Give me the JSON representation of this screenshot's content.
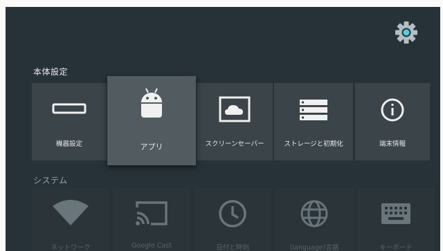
{
  "device_settings": {
    "title": "本体設定",
    "items": [
      {
        "label": "機器設定",
        "icon": "set-top-box-icon"
      },
      {
        "label": "アプリ",
        "icon": "android-icon"
      },
      {
        "label": "スクリーンセーバー",
        "icon": "screensaver-icon"
      },
      {
        "label": "ストレージと初期化",
        "icon": "storage-icon"
      },
      {
        "label": "端末情報",
        "icon": "info-icon"
      }
    ]
  },
  "system": {
    "title": "システム",
    "items": [
      {
        "label": "ネットワーク",
        "icon": "wifi-icon"
      },
      {
        "label": "Google Cast",
        "icon": "cast-icon"
      },
      {
        "label": "日付と時刻",
        "icon": "clock-icon"
      },
      {
        "label": "(language)言語",
        "icon": "globe-icon"
      },
      {
        "label": "キーボード",
        "icon": "keyboard-icon"
      }
    ]
  },
  "colors": {
    "background": "#263238",
    "card": "#3a4449",
    "card_focused": "#515b60",
    "accent": "#4dd0e1"
  }
}
